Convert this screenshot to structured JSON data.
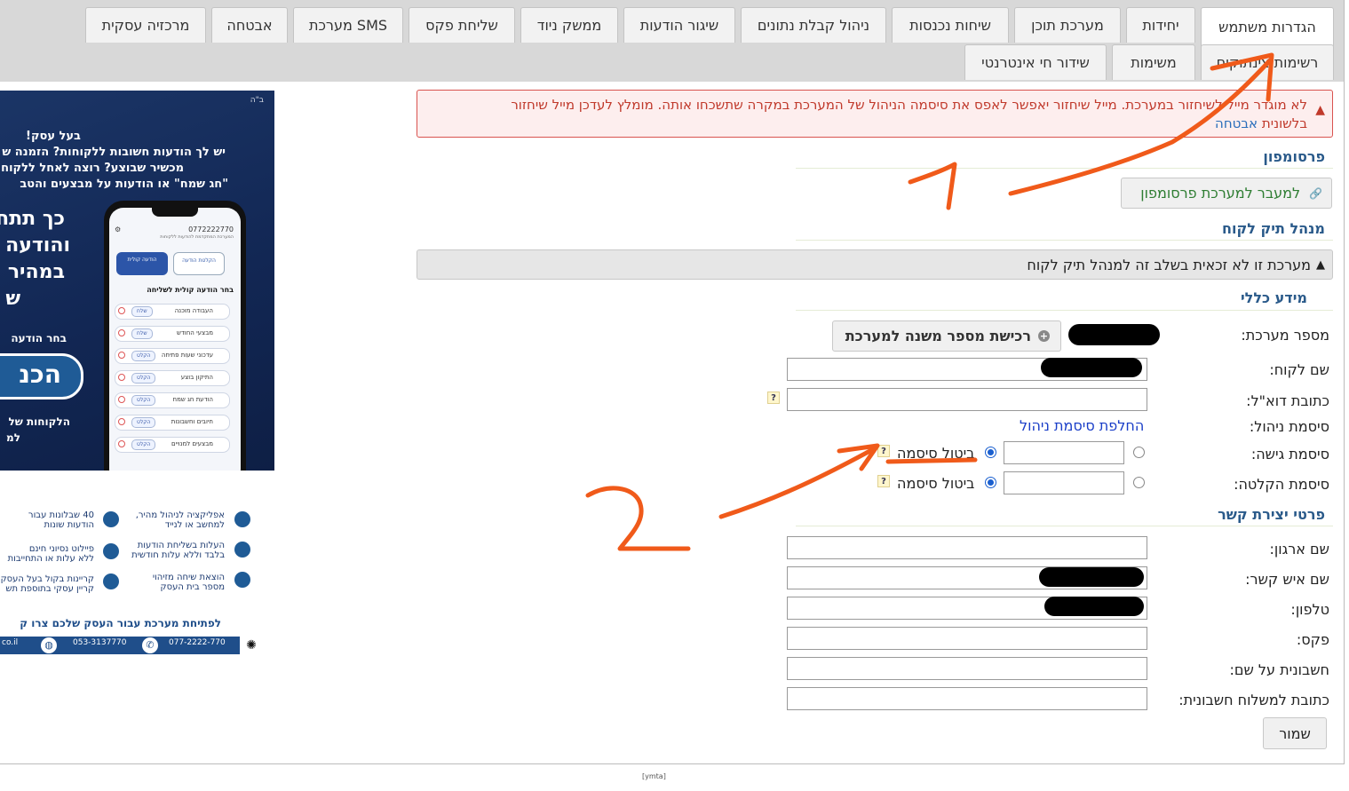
{
  "tabs_row1": [
    {
      "label": "הגדרות משתמש",
      "active": true
    },
    {
      "label": "יחידות"
    },
    {
      "label": "מערכת תוכן"
    },
    {
      "label": "שיחות נכנסות"
    },
    {
      "label": "ניהול קבלת נתונים"
    },
    {
      "label": "שיגור הודעות"
    },
    {
      "label": "ממשק ניוד"
    },
    {
      "label": "שליחת פקס"
    },
    {
      "label": "מערכת SMS"
    },
    {
      "label": "אבטחה"
    },
    {
      "label": "מרכזיה עסקית"
    }
  ],
  "tabs_row2": [
    {
      "label": "רשימות צינתוקים"
    },
    {
      "label": "משימות"
    },
    {
      "label": "שידור חי אינטרנטי"
    }
  ],
  "alert": {
    "icon": "warning-icon",
    "text": "לא מוגדר מייל לשיחזור במערכת. מייל שיחזור יאפשר לאפס את סיסמה הניהול של המערכת במקרה שתשכחו אותה. מומלץ לעדכן מייל שיחזור",
    "text2": "בלשונית",
    "link": "אבטחה"
  },
  "promo": {
    "title": "פרסומפון",
    "button": "למעבר למערכת פרסומפון",
    "button_icon": "link-icon",
    "button_color": "#2e7d32"
  },
  "file_manager": {
    "title": "מנהל תיק לקוח",
    "notice": "מערכת זו לא זכאית בשלב זה למנהל תיק לקוח"
  },
  "general": {
    "title": "מידע כללי",
    "system_number_label": "מספר מערכת:",
    "buy_button": "רכישת מספר משנה למערכת",
    "customer_name_label": "שם לקוח:",
    "email_label": "כתובת דוא\"ל:",
    "mgmt_password_label": "סיסמת ניהול:",
    "change_password_link": "החלפת סיסמת ניהול",
    "access_password_label": "סיסמת גישה:",
    "record_password_label": "סיסמת הקלטה:",
    "cancel_password": "ביטול סיסמה",
    "help": "?"
  },
  "contact": {
    "title": "פרטי יצירת קשר",
    "org_name": "שם ארגון:",
    "contact_name": "שם איש קשר:",
    "phone": "טלפון:",
    "fax": "פקס:",
    "invoice_name": "חשבונית על שם:",
    "invoice_address": "כתובת למשלוח חשבונית:"
  },
  "save_button": "שמור",
  "footer": "[ymta]",
  "ad": {
    "corner": "ב\"ה",
    "line1": "בעל עסק!",
    "line2": "יש לך הודעות חשובות ללקוחות? הזמנה ש",
    "line3": "מכשיר שבוצע? רוצה לאחל ללקוח",
    "line4": "\"חג שמח\" או הודעות על מבצעים והטב",
    "big1": "כך תתח",
    "big2": "והודעה",
    "big3": "במהיר",
    "big4": "ש",
    "choose": "בחר הודעה",
    "bigword": "הכנ",
    "clients1": "הלקוחות של",
    "clients2": "למ",
    "phone_num": "0772222770",
    "phone_sub": "המערכת המתקדמת להודעות ללקוחות",
    "btn_voice": "הודעה קולית",
    "btn_record": "הקלטת הודעה",
    "phone_heading": "בחר הודעה קולית לשליחה",
    "phone_items": [
      {
        "name": "העבודה מוכנה",
        "pill": "שלח"
      },
      {
        "name": "מבצעי החודש",
        "pill": "שלח"
      },
      {
        "name": "עדכוני שעות פתיחה",
        "pill": "הקלט"
      },
      {
        "name": "התיקון בוצע",
        "pill": "הקלט"
      },
      {
        "name": "הודעת חג שמח",
        "pill": "הקלט"
      },
      {
        "name": "חיובים וחשבונות",
        "pill": "הקלט"
      },
      {
        "name": "מבצעים למנויים",
        "pill": "הקלט"
      }
    ],
    "features": [
      {
        "a": "אפליקציה לניהול מהיר,",
        "b": "למחשב או לנייד"
      },
      {
        "a": "40 שבלונות עבור",
        "b": "הודעות שונות"
      },
      {
        "a": "העלות בשליחת הודעות",
        "b": "בלבד וללא עלות חודשית"
      },
      {
        "a": "פיילוט נסיוני חינם",
        "b": "ללא עלות או התחייבות"
      },
      {
        "a": "הוצאת שיחה מזיהוי",
        "b": "מספר בית העסק"
      },
      {
        "a": "קריינות בקול בעל העסק",
        "b": "קריין עסקי בתוספת תש"
      }
    ],
    "cta": "לפתיחת מערכת עבור העסק שלכם צרו ק",
    "tel1": "077-2222-770",
    "tel2": "053-3137770",
    "web": "co.il"
  },
  "annotations": {
    "one": "1",
    "two": "2",
    "color": "#f05a1a"
  }
}
